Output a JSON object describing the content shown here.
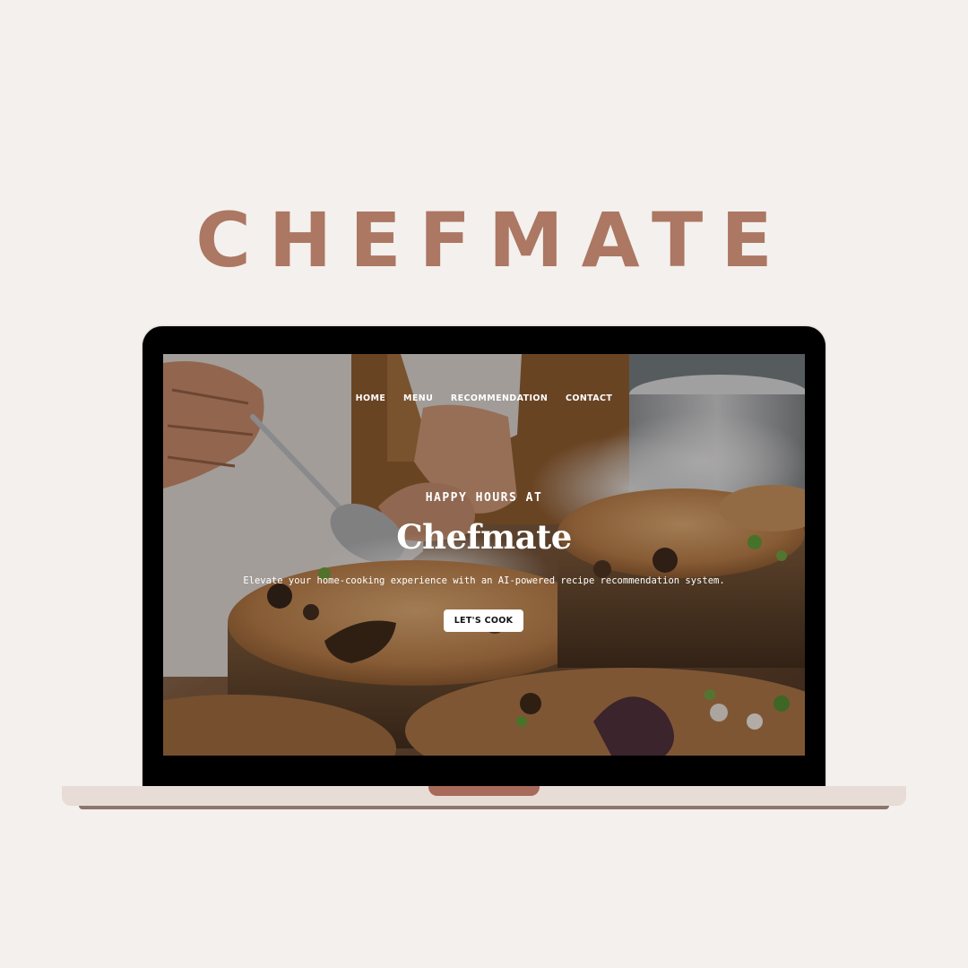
{
  "brand": {
    "title": "CHEFMATE"
  },
  "site": {
    "nav": {
      "home": "HOME",
      "menu": "MENU",
      "recommendation": "RECOMMENDATION",
      "contact": "CONTACT"
    },
    "hero": {
      "eyebrow": "HAPPY HOURS AT",
      "title": "Chefmate",
      "subtitle": "Elevate your home-cooking experience with an AI-powered recipe recommendation system.",
      "cta_label": "LET'S COOK"
    }
  },
  "colors": {
    "page_background": "#f4f0ed",
    "brand_accent": "#ac7763",
    "laptop_base": "#e8dcd6",
    "laptop_notch": "#a86a5a",
    "cta_background": "#ffffff"
  }
}
